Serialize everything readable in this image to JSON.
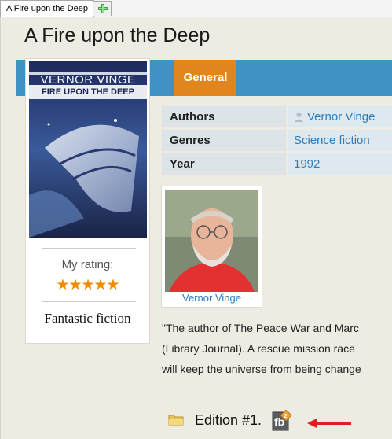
{
  "tabs": {
    "active_label": "A Fire upon the Deep",
    "add_icon": "plus-icon"
  },
  "book": {
    "title": "A Fire upon the Deep",
    "cover": {
      "author_text": "VERNOR VINGE",
      "title_text": "FIRE UPON THE DEEP"
    },
    "rating_label": "My rating:",
    "stars": "★★★★★",
    "rating_value": 5,
    "shelf": "Fantastic fiction"
  },
  "section_tab": "General",
  "info": {
    "rows": [
      {
        "key": "Authors",
        "value": "Vernor Vinge"
      },
      {
        "key": "Genres",
        "value": "Science fiction"
      },
      {
        "key": "Year",
        "value": "1992"
      }
    ]
  },
  "author_card": {
    "name": "Vernor Vinge"
  },
  "description": {
    "line1": "\"The author of The Peace War and Marc",
    "line2": "(Library Journal). A rescue mission race",
    "line3": "will keep the universe from being change"
  },
  "edition": {
    "label": "Edition #1.",
    "icon": "fb2-file-icon"
  },
  "colors": {
    "accent_blue": "#3f93c4",
    "tab_orange": "#e0861d",
    "link": "#2e7cba",
    "arrow": "#e02020"
  }
}
